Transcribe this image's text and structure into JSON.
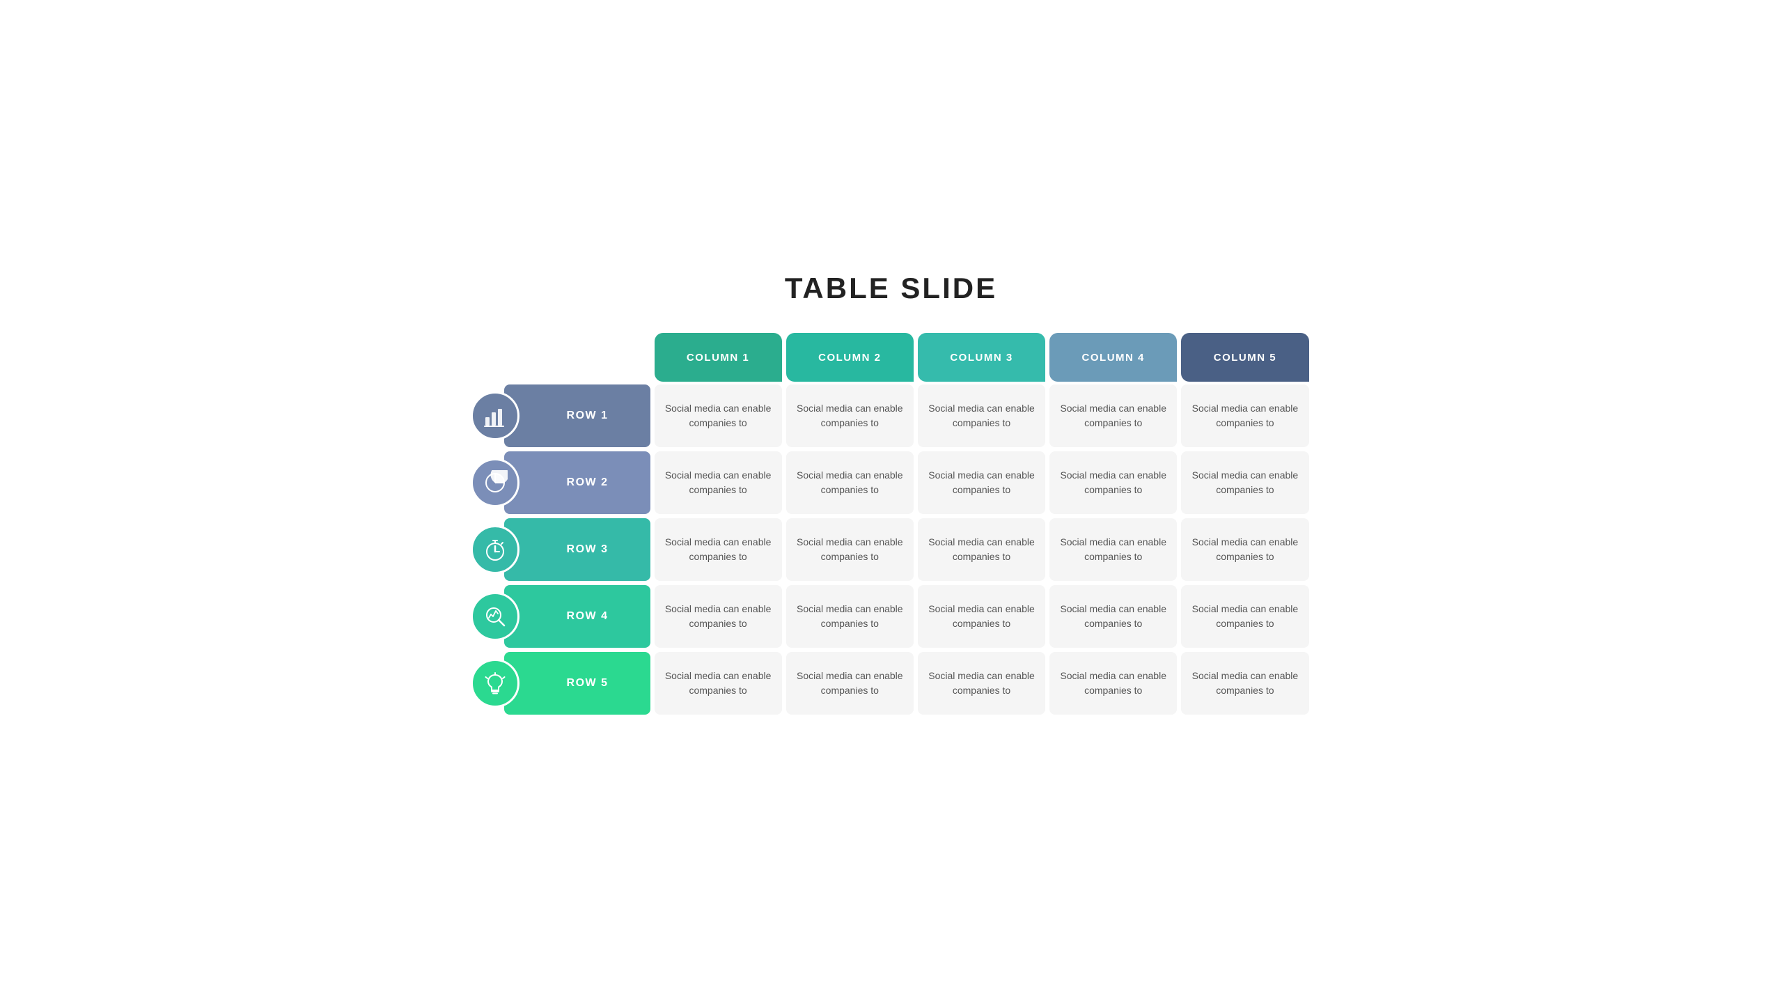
{
  "title": "TABLE SLIDE",
  "columns": [
    {
      "id": "col1",
      "label": "COLUMN 1",
      "color": "#2BAD8E"
    },
    {
      "id": "col2",
      "label": "COLUMN 2",
      "color": "#28B8A0"
    },
    {
      "id": "col3",
      "label": "COLUMN 3",
      "color": "#35BBAC"
    },
    {
      "id": "col4",
      "label": "COLUMN 4",
      "color": "#6B9BB8"
    },
    {
      "id": "col5",
      "label": "COLUMN 5",
      "color": "#4A6085"
    }
  ],
  "rows": [
    {
      "id": "row1",
      "label": "ROW 1",
      "icon": "bar-chart",
      "rowColor": "#6B7FA3",
      "iconBgColor": "#6B7FA3",
      "iconStrokeColor": "#6B7FA3",
      "cellText": "Social media can enable companies to"
    },
    {
      "id": "row2",
      "label": "ROW 2",
      "icon": "pie-chart",
      "rowColor": "#7B8EB8",
      "iconBgColor": "#7B8EB8",
      "iconStrokeColor": "#7B8EB8",
      "cellText": "Social media can enable companies to"
    },
    {
      "id": "row3",
      "label": "ROW 3",
      "icon": "stopwatch",
      "rowColor": "#35BAA8",
      "iconBgColor": "#35BAA8",
      "iconStrokeColor": "#35BAA8",
      "cellText": "Social media can enable companies to"
    },
    {
      "id": "row4",
      "label": "ROW 4",
      "icon": "search-chart",
      "rowColor": "#2DC89E",
      "iconBgColor": "#2DC89E",
      "iconStrokeColor": "#2DC89E",
      "cellText": "Social media can enable companies to"
    },
    {
      "id": "row5",
      "label": "ROW 5",
      "icon": "lightbulb",
      "rowColor": "#2BD990",
      "iconBgColor": "#2BD990",
      "iconStrokeColor": "#2BD990",
      "cellText": "Social media can enable companies to"
    }
  ],
  "cell_text": "Social media can enable companies to"
}
